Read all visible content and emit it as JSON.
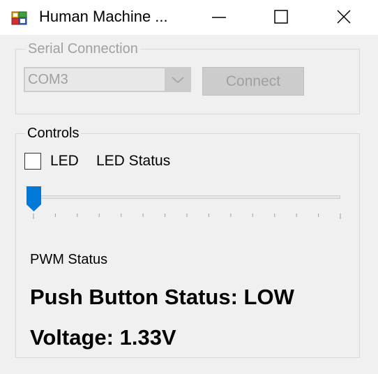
{
  "window": {
    "title": "Human Machine ...",
    "icon": "app-icon",
    "minimize_icon": "minimize-icon",
    "maximize_icon": "maximize-icon",
    "close_icon": "close-icon"
  },
  "serial": {
    "group_label": "Serial Connection",
    "port_value": "COM3",
    "connect_label": "Connect",
    "enabled": false
  },
  "controls": {
    "group_label": "Controls",
    "led_label": "LED",
    "led_checked": false,
    "led_status": "LED Status",
    "slider_value": 0,
    "slider_tick_count": 15,
    "pwm_status": "PWM Status",
    "push_button_status": "Push Button Status: LOW",
    "voltage": "Voltage: 1.33V"
  },
  "colors": {
    "accent": "#0078d7",
    "disabled_text": "#a0a0a0",
    "window_bg": "#f0f0f0"
  }
}
